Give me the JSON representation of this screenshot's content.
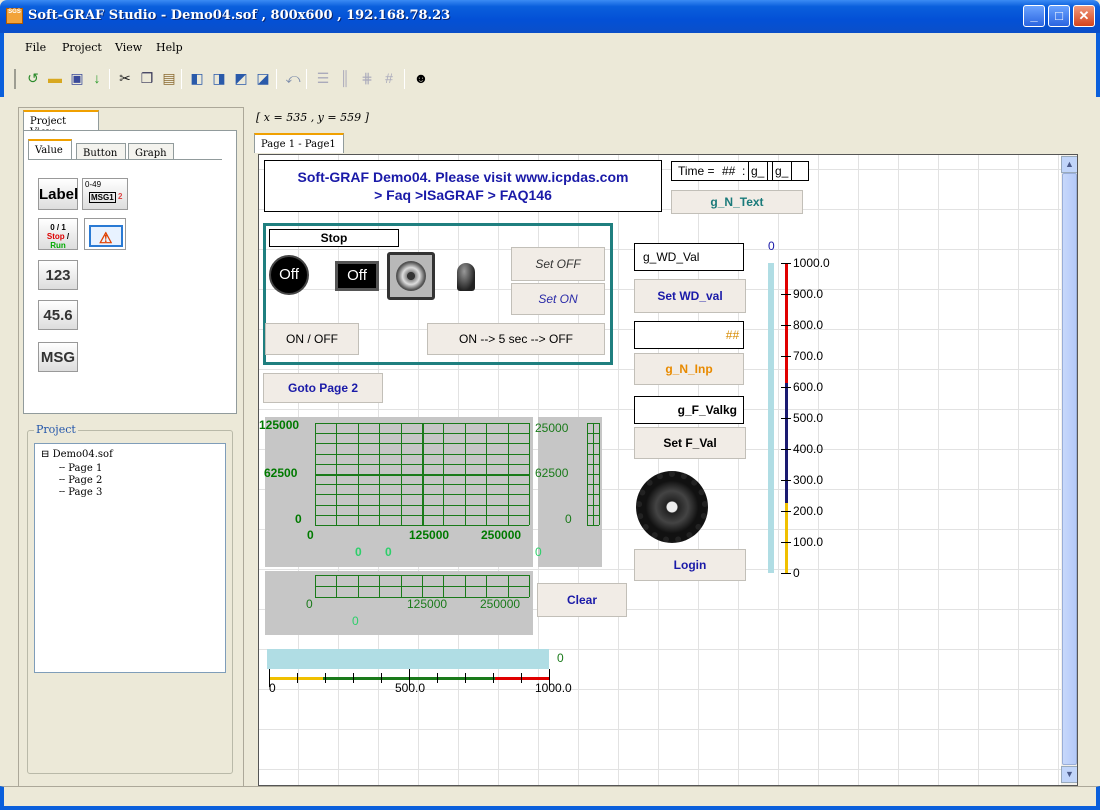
{
  "window": {
    "title": "Soft-GRAF Studio - Demo04.sof , 800x600 , 192.168.78.23",
    "app_icon_text": "SGS"
  },
  "menu": [
    "File",
    "Project",
    "View",
    "Help"
  ],
  "toolbar_icons": [
    "new-icon",
    "open-icon",
    "save-icon",
    "download-icon",
    "cut-icon",
    "copy-icon",
    "paste-icon",
    "bring-front-icon",
    "send-back-icon",
    "bring-forward-icon",
    "send-backward-icon",
    "undo-icon",
    "align-icon",
    "distribute-icon",
    "spacing-icon",
    "grid-icon",
    "user-icon"
  ],
  "left_panel": {
    "tab": "Project View",
    "subtabs": [
      "Value",
      "Button",
      "Graph"
    ],
    "palette": {
      "label_btn": "Label",
      "msg_range": "0-49",
      "msg_box": "MSG1",
      "msg_num": "2",
      "bool_top": "0 / 1",
      "bool_stop": "Stop",
      "bool_slash": " / ",
      "bool_run": "Run",
      "int_btn": "123",
      "real_btn": "45.6",
      "msg_btn": "MSG"
    },
    "project_group": "Project",
    "tree": {
      "root": "Demo04.sof",
      "expander": "⊟",
      "pages": [
        "Page 1",
        "Page 2",
        "Page 3"
      ]
    }
  },
  "coords": "[ x = 535 , y = 559 ]",
  "page_tab": "Page 1 - Page1",
  "canvas": {
    "title_line1": "Soft-GRAF Demo04. Please visit www.icpdas.com",
    "title_line2": "> Faq >ISaGRAF > FAQ146",
    "time_label": "Time = ",
    "time_hash": "##",
    "time_colon": ":",
    "time_f1": "g_",
    "time_f2": "g_",
    "text_btn": "g_N_Text",
    "stop_label": "Stop",
    "off1": "Off",
    "off2": "Off",
    "set_off": "Set OFF",
    "set_on": "Set ON",
    "on_off": "ON / OFF",
    "on_5sec": "ON --> 5 sec --> OFF",
    "goto_page2": "Goto Page 2",
    "wd_val": "g_WD_Val",
    "set_wd": "Set WD_val",
    "inp_hash": "##",
    "n_inp": "g_N_Inp",
    "f_valkg": "g_F_Valkg",
    "set_f": "Set F_Val",
    "login": "Login",
    "clear": "Clear",
    "vbar_zero": "0",
    "hbar_zero": "0",
    "colors": {
      "accent": "#1a1aa8",
      "teal_border": "#1f7f7f",
      "grid_green": "#1a7a1a",
      "bar_fill": "#b0dde4"
    }
  },
  "trend": {
    "y_max": "125000",
    "y_mid": "62500",
    "y_min": "0",
    "x_0": "0",
    "x_1": "125000",
    "x_2": "250000",
    "cur_a": "0",
    "cur_b": "0"
  },
  "mini_trend": {
    "y_max": "25000",
    "y_mid": "62500",
    "y_min": "0",
    "cur": "0"
  },
  "x_trend": {
    "x_0": "0",
    "x_1": "125000",
    "x_2": "250000",
    "cur": "0"
  },
  "vscale": [
    "1000.0",
    "900.0",
    "800.0",
    "700.0",
    "600.0",
    "500.0",
    "400.0",
    "300.0",
    "200.0",
    "100.0",
    "0"
  ],
  "hscale": [
    "0",
    "500.0",
    "1000.0"
  ]
}
